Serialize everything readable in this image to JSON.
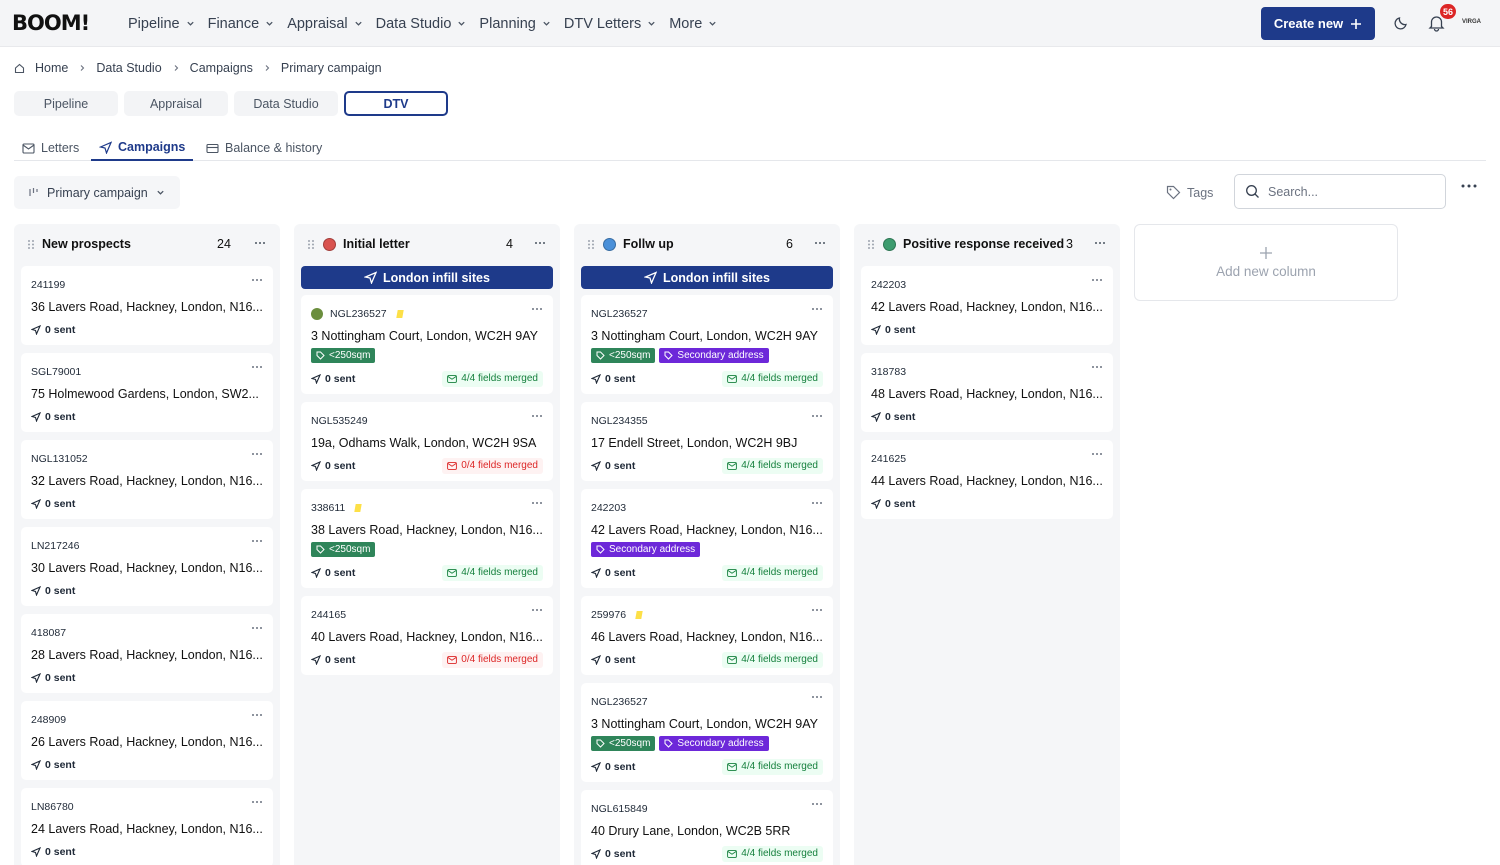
{
  "app": {
    "logo": "BOOM!"
  },
  "nav": [
    {
      "label": "Pipeline"
    },
    {
      "label": "Finance"
    },
    {
      "label": "Appraisal"
    },
    {
      "label": "Data Studio"
    },
    {
      "label": "Planning"
    },
    {
      "label": "DTV Letters"
    },
    {
      "label": "More"
    }
  ],
  "header": {
    "create_label": "Create new",
    "notification_count": "56",
    "avatar_text": "VIRGA"
  },
  "breadcrumb": [
    "Home",
    "Data Studio",
    "Campaigns",
    "Primary campaign"
  ],
  "section_tabs": [
    {
      "label": "Pipeline"
    },
    {
      "label": "Appraisal"
    },
    {
      "label": "Data Studio"
    },
    {
      "label": "DTV",
      "active": true
    }
  ],
  "sub_tabs": [
    {
      "label": "Letters"
    },
    {
      "label": "Campaigns",
      "active": true
    },
    {
      "label": "Balance & history"
    }
  ],
  "toolbar": {
    "campaign_filter": "Primary campaign",
    "tags_label": "Tags",
    "search_placeholder": "Search..."
  },
  "columns": [
    {
      "title": "New prospects",
      "count": "24",
      "dot_color": null,
      "campaign": null,
      "cards": [
        {
          "id": "241199",
          "address": "36 Lavers Road, Hackney, London, N16...",
          "sent": "0 sent"
        },
        {
          "id": "SGL79001",
          "address": "75 Holmewood Gardens, London, SW2...",
          "sent": "0 sent"
        },
        {
          "id": "NGL131052",
          "address": "32 Lavers Road, Hackney, London, N16...",
          "sent": "0 sent"
        },
        {
          "id": "LN217246",
          "address": "30 Lavers Road, Hackney, London, N16...",
          "sent": "0 sent"
        },
        {
          "id": "418087",
          "address": "28 Lavers Road, Hackney, London, N16...",
          "sent": "0 sent"
        },
        {
          "id": "248909",
          "address": "26 Lavers Road, Hackney, London, N16...",
          "sent": "0 sent"
        },
        {
          "id": "LN86780",
          "address": "24 Lavers Road, Hackney, London, N16...",
          "sent": "0 sent"
        }
      ]
    },
    {
      "title": "Initial letter",
      "count": "4",
      "dot_color": "#d9534f",
      "campaign": "London infill sites",
      "cards": [
        {
          "id": "NGL236527",
          "address": "3 Nottingham Court, London, WC2H 9AY",
          "sent": "0 sent",
          "status_dot": "#6b8e3d",
          "flag": true,
          "tags": [
            {
              "label": "<250sqm",
              "color": "green"
            }
          ],
          "merged": {
            "label": "4/4 fields merged",
            "ok": true
          }
        },
        {
          "id": "NGL535249",
          "address": "19a, Odhams Walk, London, WC2H 9SA",
          "sent": "0 sent",
          "merged": {
            "label": "0/4 fields merged",
            "ok": false
          }
        },
        {
          "id": "338611",
          "address": "38 Lavers Road, Hackney, London, N16...",
          "sent": "0 sent",
          "flag": true,
          "tags": [
            {
              "label": "<250sqm",
              "color": "green"
            }
          ],
          "merged": {
            "label": "4/4 fields merged",
            "ok": true
          }
        },
        {
          "id": "244165",
          "address": "40 Lavers Road, Hackney, London, N16...",
          "sent": "0 sent",
          "merged": {
            "label": "0/4 fields merged",
            "ok": false
          }
        }
      ]
    },
    {
      "title": "Follw up",
      "count": "6",
      "dot_color": "#4a90d9",
      "campaign": "London infill sites",
      "cards": [
        {
          "id": "NGL236527",
          "address": "3 Nottingham Court, London, WC2H 9AY",
          "sent": "0 sent",
          "tags": [
            {
              "label": "<250sqm",
              "color": "green"
            },
            {
              "label": "Secondary address",
              "color": "purple"
            }
          ],
          "merged": {
            "label": "4/4 fields merged",
            "ok": true
          }
        },
        {
          "id": "NGL234355",
          "address": "17 Endell Street, London, WC2H 9BJ",
          "sent": "0 sent",
          "merged": {
            "label": "4/4 fields merged",
            "ok": true
          }
        },
        {
          "id": "242203",
          "address": "42 Lavers Road, Hackney, London, N16...",
          "sent": "0 sent",
          "tags": [
            {
              "label": "Secondary address",
              "color": "purple"
            }
          ],
          "merged": {
            "label": "4/4 fields merged",
            "ok": true
          }
        },
        {
          "id": "259976",
          "address": "46 Lavers Road, Hackney, London, N16...",
          "sent": "0 sent",
          "flag": true,
          "merged": {
            "label": "4/4 fields merged",
            "ok": true
          }
        },
        {
          "id": "NGL236527",
          "address": "3 Nottingham Court, London, WC2H 9AY",
          "sent": "0 sent",
          "tags": [
            {
              "label": "<250sqm",
              "color": "green"
            },
            {
              "label": "Secondary address",
              "color": "purple"
            }
          ],
          "merged": {
            "label": "4/4 fields merged",
            "ok": true
          }
        },
        {
          "id": "NGL615849",
          "address": "40 Drury Lane, London, WC2B 5RR",
          "sent": "0 sent",
          "merged": {
            "label": "4/4 fields merged",
            "ok": true
          }
        }
      ]
    },
    {
      "title": "Positive response received",
      "count": "3",
      "dot_color": "#3d9c6f",
      "campaign": null,
      "cards": [
        {
          "id": "242203",
          "address": "42 Lavers Road, Hackney, London, N16...",
          "sent": "0 sent"
        },
        {
          "id": "318783",
          "address": "48 Lavers Road, Hackney, London, N16...",
          "sent": "0 sent"
        },
        {
          "id": "241625",
          "address": "44 Lavers Road, Hackney, London, N16...",
          "sent": "0 sent"
        }
      ]
    }
  ],
  "add_column_label": "Add new column"
}
